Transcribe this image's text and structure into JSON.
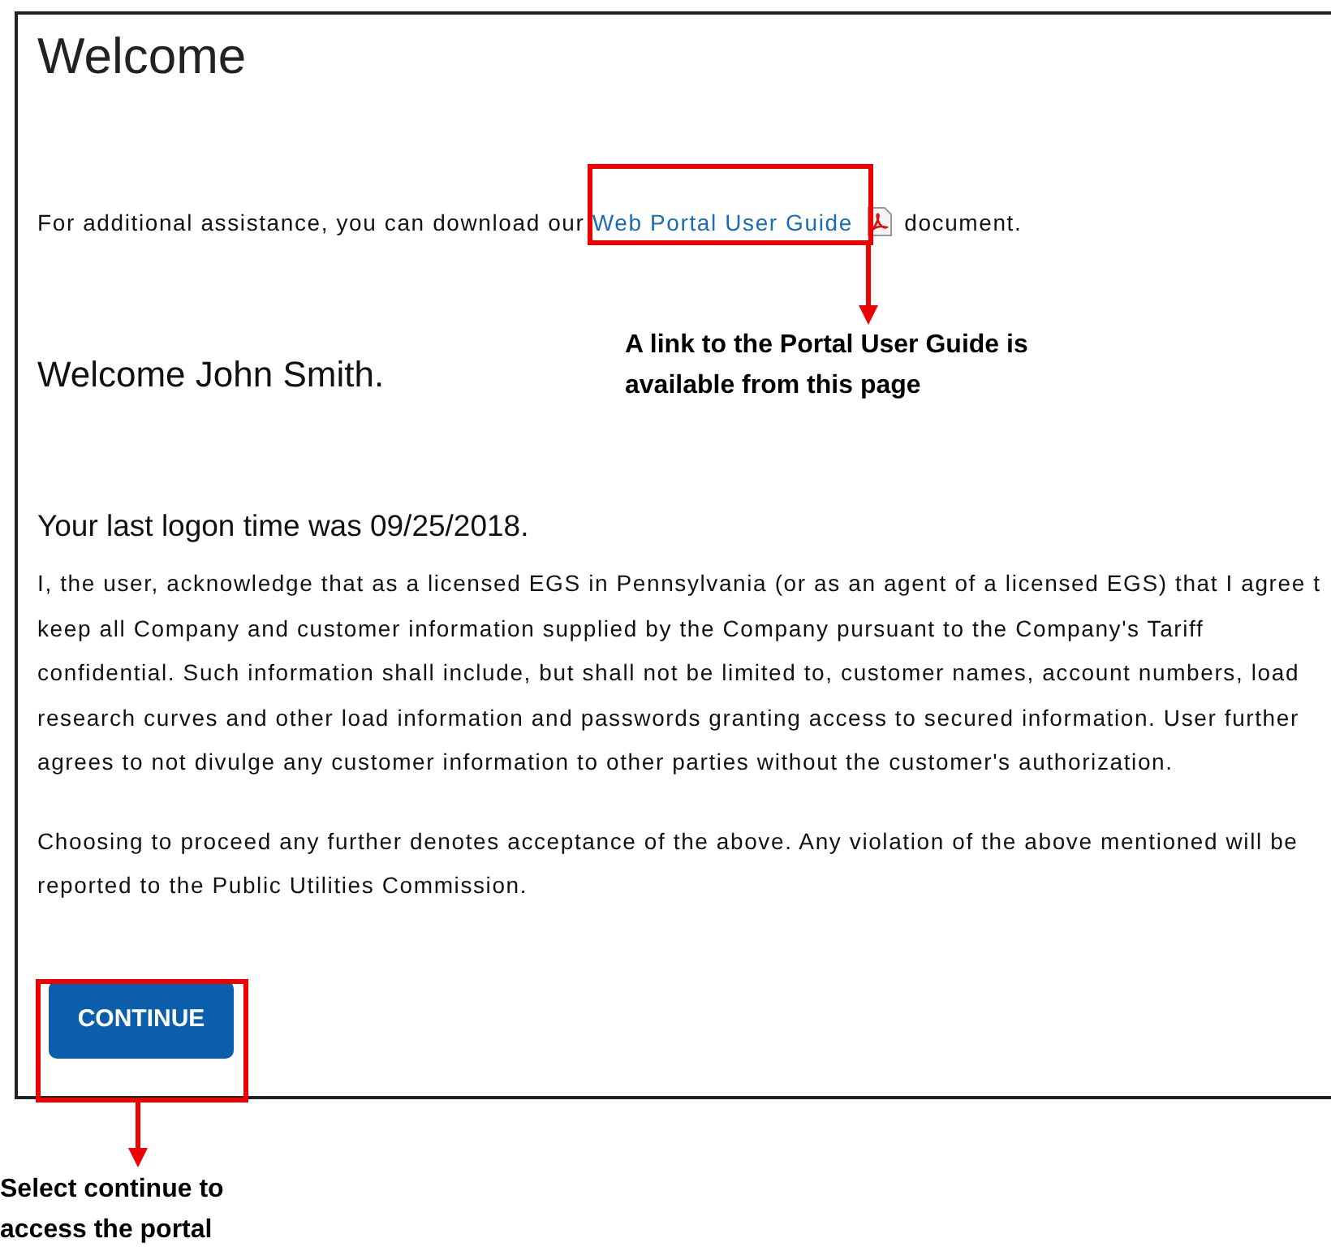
{
  "page": {
    "title": "Welcome",
    "assistance": {
      "before": "For additional assistance, you can download our",
      "link": "Web Portal User Guide",
      "after": "document."
    },
    "greeting": "Welcome John Smith.",
    "last_logon": "Your last logon time was 09/25/2018.",
    "agreement_lines": [
      "I, the user, acknowledge that as a licensed EGS in Pennsylvania (or as an agent of a licensed EGS) that I agree t",
      "keep all Company and customer information supplied by the Company pursuant to the Company's Tariff",
      "confidential. Such information shall include, but shall not be limited to, customer names, account numbers, load",
      "research curves and other load information and passwords granting access to secured information. User further",
      "agrees to not divulge any customer information to other parties without the customer's authorization."
    ],
    "notice_lines": [
      "Choosing to proceed any further denotes acceptance of the above. Any violation of the above mentioned will be",
      "reported to the Public Utilities Commission."
    ],
    "continue_button": "CONTINUE"
  },
  "annotations": [
    {
      "kind": "link",
      "lines": [
        "A link to the Portal User Guide is",
        "available from this page"
      ]
    },
    {
      "kind": "button",
      "lines": [
        "Select continue to",
        "access the portal"
      ]
    }
  ]
}
